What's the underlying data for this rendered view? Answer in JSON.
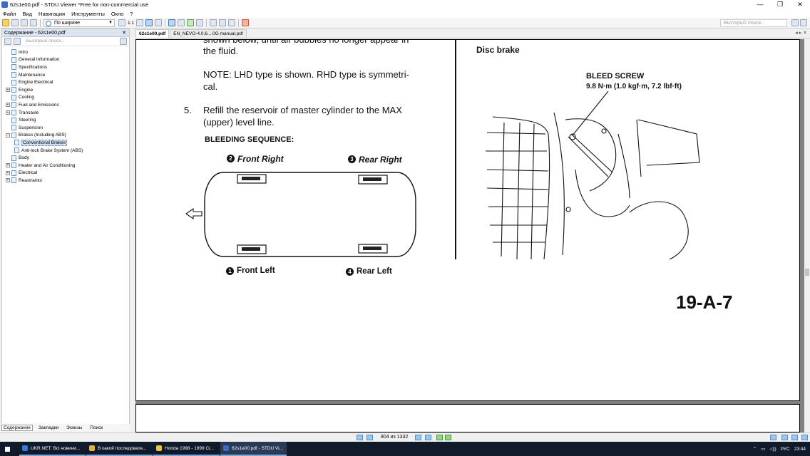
{
  "window": {
    "title": "62s1e00.pdf - STDU Viewer *Free for non-commercial use",
    "minimize": "—",
    "maximize": "❐",
    "close": "✕"
  },
  "menu": [
    "Файл",
    "Вид",
    "Навигация",
    "Инструменты",
    "Окно",
    "?"
  ],
  "toolbar": {
    "page_fit_label": "1:1",
    "zoom_mode": "По ширине",
    "search_placeholder": "Быстрый поиск..."
  },
  "sidebar": {
    "header": "Содержание - 62s1e00.pdf",
    "close": "✕",
    "search_placeholder": "Быстрый поиск...",
    "items": [
      {
        "label": "Intro",
        "level": 1,
        "expandable": false
      },
      {
        "label": "General Information",
        "level": 1,
        "expandable": false
      },
      {
        "label": "Specifications",
        "level": 1,
        "expandable": false
      },
      {
        "label": "Maintenance",
        "level": 1,
        "expandable": false
      },
      {
        "label": "Engine Electrical",
        "level": 1,
        "expandable": false
      },
      {
        "label": "Engine",
        "level": 1,
        "expandable": true
      },
      {
        "label": "Cooling",
        "level": 1,
        "expandable": false
      },
      {
        "label": "Fuel and Emissions",
        "level": 1,
        "expandable": true
      },
      {
        "label": "Transaxle",
        "level": 1,
        "expandable": true
      },
      {
        "label": "Steering",
        "level": 1,
        "expandable": false
      },
      {
        "label": "Suspension",
        "level": 1,
        "expandable": false
      },
      {
        "label": "Brakes (Including ABS)",
        "level": 1,
        "expandable": true,
        "expanded": true
      },
      {
        "label": "Conventional Brakes",
        "level": 2,
        "expandable": false,
        "selected": true
      },
      {
        "label": "Anti-lock Brake System (ABS)",
        "level": 2,
        "expandable": false
      },
      {
        "label": "Body",
        "level": 1,
        "expandable": false
      },
      {
        "label": "Heater and Air Conditioning",
        "level": 1,
        "expandable": true
      },
      {
        "label": "Electrical",
        "level": 1,
        "expandable": true
      },
      {
        "label": "Reastraints",
        "level": 1,
        "expandable": true
      }
    ],
    "tabs": [
      "Содержание",
      "Закладки",
      "Эскизы",
      "Поиск"
    ]
  },
  "doc_tabs": [
    "62s1e00.pdf",
    "EN_NEVO-4.0.6....0G manual.pdf"
  ],
  "page": {
    "line_top_1": "shown below, until air bubbles no longer appear in",
    "line_top_2": "the fluid.",
    "note_1": "NOTE:  LHD type is shown. RHD type is symmetri-",
    "note_2": "cal.",
    "step_num": "5.",
    "step_1": "Refill the reservoir of master cylinder to the MAX",
    "step_2": "(upper) level line.",
    "bleed_heading": "BLEEDING SEQUENCE:",
    "wheel_2": "Front Right",
    "wheel_3": "Rear Right",
    "wheel_1": "Front Left",
    "wheel_4": "Rear Left",
    "num_1": "1",
    "num_2": "2",
    "num_3": "3",
    "num_4": "4",
    "disc_heading": "Disc brake",
    "screw_label": "BLEED SCREW",
    "screw_torque": "9.8 N·m (1.0 kgf·m, 7.2 lbf·ft)",
    "page_code": "19-A-7"
  },
  "status": {
    "page_counter": "804 из 1332"
  },
  "taskbar": {
    "tasks": [
      "UKR.NET: Всі новини...",
      "В какой последовате...",
      "Honda 1998 - 1999 Ci...",
      "62s1e00.pdf - STDU Vi..."
    ],
    "lang": "РУС",
    "time": "23:44"
  }
}
